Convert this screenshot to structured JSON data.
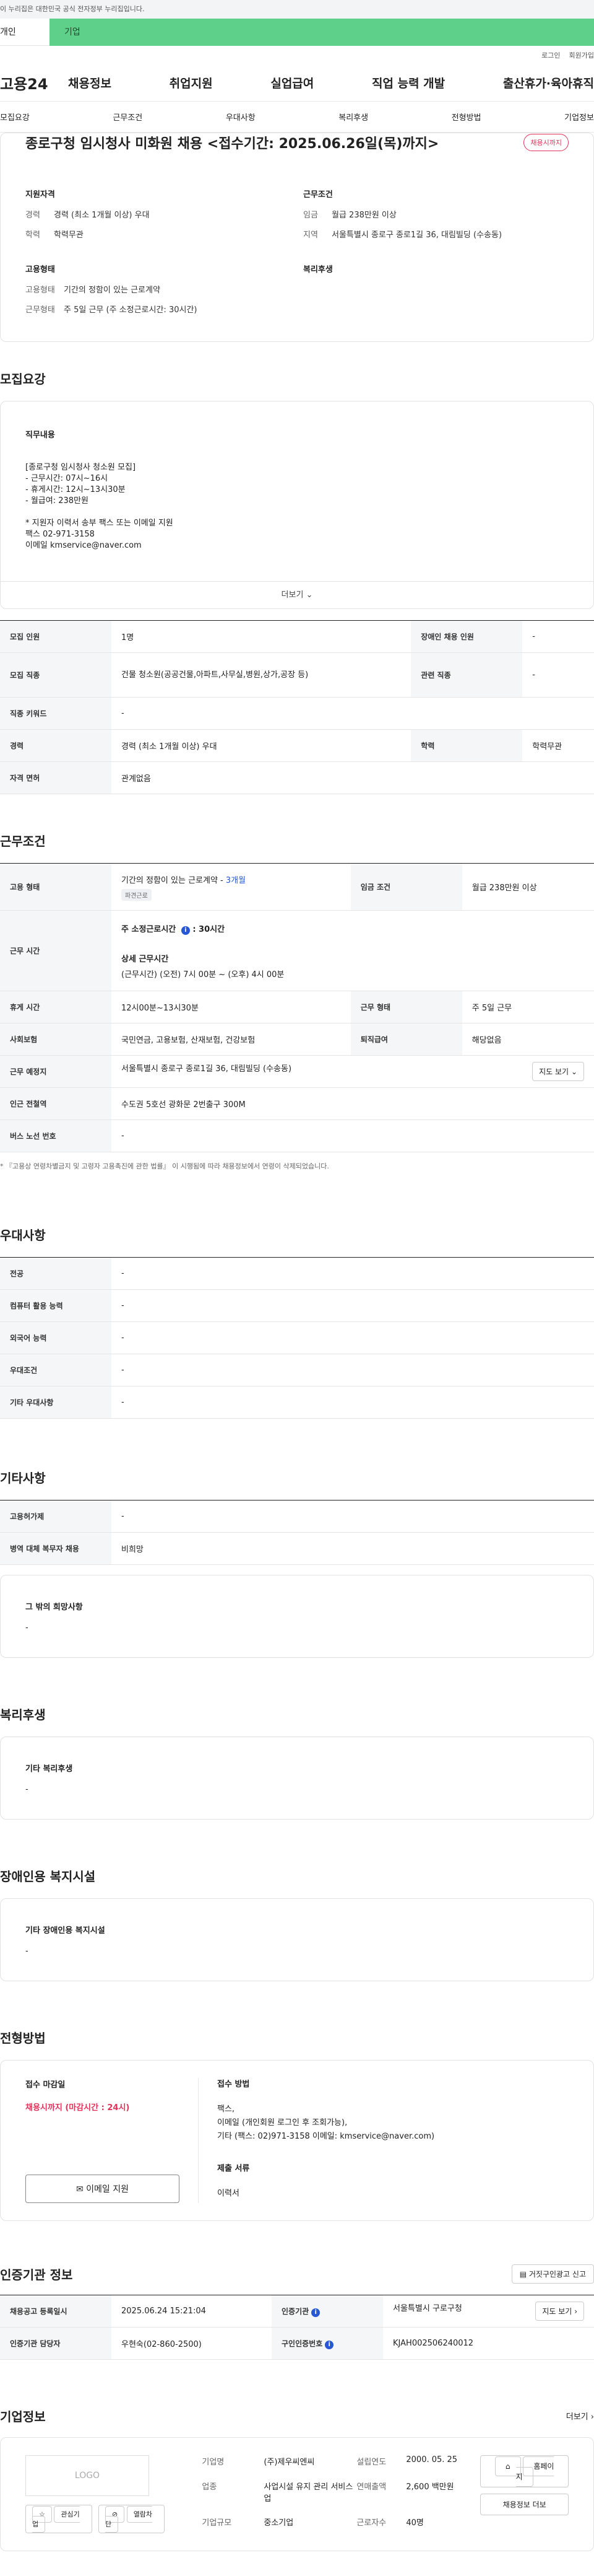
{
  "banner": {
    "text": "이 누리집은 대한민국 공식 전자정부 누리집입니다."
  },
  "top_tabs": {
    "tab_personal": "개인",
    "tab_company": "기업"
  },
  "util": {
    "login": "로그인",
    "join": "회원가입"
  },
  "gnb": {
    "logo": "고용24",
    "menu": [
      "채용정보",
      "취업지원",
      "실업급여",
      "직업 능력 개발",
      "출산휴가·육아휴직"
    ]
  },
  "subnav": [
    "모집요강",
    "근무조건",
    "우대사항",
    "복리후생",
    "전형방법",
    "기업정보"
  ],
  "job": {
    "title": "종로구청 임시청사 미화원 채용 <접수기간: 2025.06.26일(목)까지>",
    "badge": "채용시까지",
    "summary": {
      "qual_title": "지원자격",
      "career_k": "경력",
      "career_v": "경력 (최소 1개월 이상) 우대",
      "edu_k": "학력",
      "edu_v": "학력무관",
      "emp_title": "고용형태",
      "emptype_k": "고용형태",
      "emptype_v": "기간의 정함이 있는 근로계약",
      "worktype_k": "근무형태",
      "worktype_v": "주 5일 근무 (주 소정근로시간: 30시간)",
      "cond_title": "근무조건",
      "wage_k": "임금",
      "wage_v": "월급 238만원 이상",
      "region_k": "지역",
      "region_v": "서울특별시 종로구 종로1길 36, 대림빌딩 (수송동)",
      "welfare_title": "복리후생"
    }
  },
  "recruit": {
    "section_title": "모집요강",
    "duty_title": "직무내용",
    "duty_text": "[종로구청 임시청사 청소원 모집]\n- 근무시간: 07시~16시\n- 휴게시간: 12시~13시30분\n- 월급여: 238만원\n\n* 지원자 이력서 송부 팩스 또는 이메일 지원\n 팩스 02-971-3158\n 이메일 kmservice@naver.com",
    "more": "더보기",
    "rows": {
      "count_k": "모집 인원",
      "count_v": "1명",
      "disabled_k": "장애인 채용 인원",
      "disabled_v": "-",
      "job_k": "모집 직종",
      "job_v": "건물 청소원(공공건물,아파트,사무실,병원,상가,공장 등)",
      "related_k": "관련 직종",
      "related_v": "-",
      "keyword_k": "직종 키워드",
      "keyword_v": "-",
      "career_k": "경력",
      "career_v": "경력 (최소 1개월 이상) 우대",
      "edu_k": "학력",
      "edu_v": "학력무관",
      "license_k": "자격 면허",
      "license_v": "관계없음"
    }
  },
  "conditions": {
    "section_title": "근무조건",
    "emptype_k": "고용 형태",
    "emptype_v": "기간의 정함이 있는 근로계약 -",
    "emptype_months": "3개월",
    "emptype_chip": "파견근로",
    "wage_k": "임금 조건",
    "wage_v": "월급 238만원 이상",
    "hours_k": "근무 시간",
    "hours_main": "주 소정근로시간",
    "hours_main_v": ": 30시간",
    "hours_detail_title": "상세 근무시간",
    "hours_detail_v": "(근무시간) (오전) 7시 00분 ~ (오후) 4시 00분",
    "break_k": "휴게 시간",
    "break_v": "12시00분~13시30분",
    "shape_k": "근무 형태",
    "shape_v": "주 5일 근무",
    "insurance_k": "사회보험",
    "insurance_v": "국민연금, 고용보험, 산재보험, 건강보험",
    "retire_k": "퇴직급여",
    "retire_v": "해당없음",
    "place_k": "근무 예정지",
    "place_v": "서울특별시 종로구 종로1길 36, 대림빌딩 (수송동)",
    "map_btn": "지도 보기",
    "subway_k": "인근 전철역",
    "subway_v": "수도권 5호선 광화문 2번출구 300M",
    "bus_k": "버스 노선 번호",
    "bus_v": "-",
    "note": "* 『고용상 연령차별금지 및 고령자 고용촉진에 관한 법률』 이 시행됨에 따라 채용정보에서 연령이 삭제되었습니다."
  },
  "preference": {
    "section_title": "우대사항",
    "major_k": "전공",
    "major_v": "-",
    "computer_k": "컴퓨터 활용 능력",
    "computer_v": "-",
    "lang_k": "외국어 능력",
    "lang_v": "-",
    "cond_k": "우대조건",
    "cond_v": "-",
    "etc_k": "기타 우대사항",
    "etc_v": "-"
  },
  "others": {
    "section_title": "기타사항",
    "permit_k": "고용허가제",
    "permit_v": "-",
    "military_k": "병역 대체 복무자 채용",
    "military_v": "비희망",
    "hope_title": "그 밖의 희망사항",
    "hope_v": "-"
  },
  "welfare": {
    "section_title": "복리후생",
    "box_title": "기타 복리후생",
    "box_v": "-"
  },
  "disabled": {
    "section_title": "장애인용 복지시설",
    "box_title": "기타 장애인용 복지시설",
    "box_v": "-"
  },
  "selection": {
    "section_title": "전형방법",
    "deadline_title": "접수 마감일",
    "deadline_v": "채용시까지 (마감시간 : 24시)",
    "email_btn": "이메일 지원",
    "method_title": "접수 방법",
    "method_v": "팩스,\n이메일 (개인회원 로그인 후 조회가능),\n기타 (팩스: 02)971-3158 이메일: kmservice@naver.com)",
    "docs_title": "제출 서류",
    "docs_v": "이력서"
  },
  "certification": {
    "section_title": "인증기관 정보",
    "report_btn": "거짓구인광고 신고",
    "reg_k": "채용공고 등록일시",
    "reg_v": "2025.06.24 15:21:04",
    "org_k": "인증기관",
    "org_v": "서울특별시 구로구청",
    "org_btn": "지도 보기",
    "manager_k": "인증기관 담당자",
    "manager_v": "우현숙(02-860-2500)",
    "number_k": "구인인증번호",
    "number_v": "KJAH002506240012"
  },
  "company": {
    "section_title": "기업정보",
    "more": "더보기",
    "logo": "LOGO",
    "fav_btn": "관심기업",
    "block_btn": "열람차단",
    "name_k": "기업명",
    "name_v": "(주)제우씨엔씨",
    "year_k": "설립연도",
    "year_v": "2000. 05. 25",
    "industry_k": "업종",
    "industry_v": "사업시설 유지 관리 서비스업",
    "sales_k": "연매출액",
    "sales_v": "2,600 백만원",
    "size_k": "기업규모",
    "size_v": "중소기업",
    "staff_k": "근로자수",
    "staff_v": "40명",
    "home_btn": "홈페이지",
    "recruit_btn": "채용정보 더보"
  }
}
